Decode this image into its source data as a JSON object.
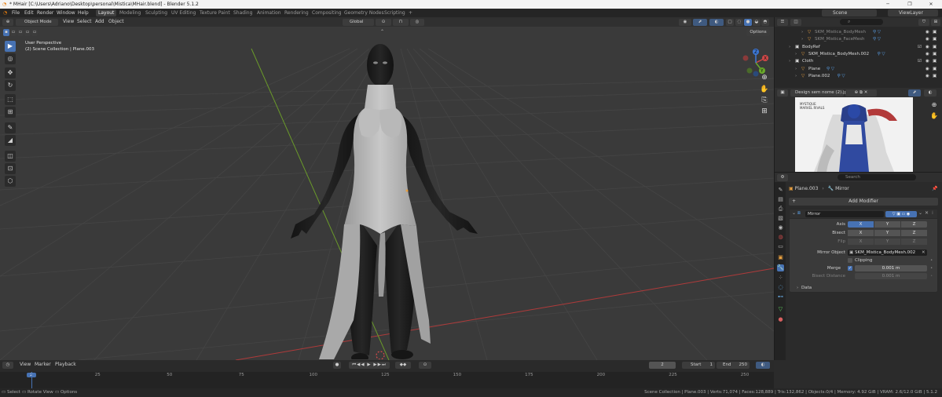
{
  "window": {
    "title": "* MHair [C:\\Users\\Adriano\\Desktop\\personal\\Mistica\\MHair.blend] - Blender 5.1.2",
    "minimize": "─",
    "maximize": "❐",
    "close": "✕"
  },
  "menu": {
    "logo": "◔",
    "items": [
      "File",
      "Edit",
      "Render",
      "Window",
      "Help"
    ],
    "workspaces": [
      "Layout",
      "Modeling",
      "Sculpting",
      "UV Editing",
      "Texture Paint",
      "Shading",
      "Animation",
      "Rendering",
      "Compositing",
      "Geometry Nodes",
      "Scripting"
    ],
    "add_workspace": "+",
    "scene": "Scene",
    "view_layer": "ViewLayer"
  },
  "viewport": {
    "mode": "Object Mode",
    "menus": [
      "View",
      "Select",
      "Add",
      "Object"
    ],
    "transform_orientation": "Global",
    "options": "Options",
    "perspective": "User Perspective",
    "collection_info": "(2) Scene Collection | Plane.003",
    "gizmo_x": "X",
    "gizmo_y": "Y",
    "gizmo_z": "Z"
  },
  "tools": [
    "▶",
    "◎",
    "✥",
    "↻",
    "⬚",
    "⊞",
    "✎",
    "◢",
    "◫",
    "⊡",
    "⬡"
  ],
  "outliner": {
    "rows": [
      {
        "name": "SKM_Mistica_BodyMesh",
        "indent": 2,
        "dim": true,
        "icon": "▽"
      },
      {
        "name": "SKM_Mistica_FaceMesh",
        "indent": 2,
        "dim": true,
        "icon": "▽"
      },
      {
        "name": "BodyRef",
        "indent": 0,
        "dim": false,
        "icon": "▣"
      },
      {
        "name": "SKM_Mistica_BodyMesh.002",
        "indent": 1,
        "dim": false,
        "icon": "▽"
      },
      {
        "name": "Cloth",
        "indent": 0,
        "dim": false,
        "icon": "▣"
      },
      {
        "name": "Plane",
        "indent": 1,
        "dim": false,
        "icon": "▽"
      },
      {
        "name": "Plane.002",
        "indent": 1,
        "dim": false,
        "icon": "▽"
      }
    ]
  },
  "image_editor": {
    "image_name": "Design sem nome (2).jpg",
    "preview_title_line1": "MYSTIQUE",
    "preview_title_line2": "MARVEL RIVALS"
  },
  "properties": {
    "search_placeholder": "Search",
    "object": "Plane.003",
    "modifier_context": "Mirror",
    "add_modifier": "Add Modifier",
    "modifier_name": "Mirror",
    "axis_label": "Axis",
    "bisect_label": "Bisect",
    "flip_label": "Flip",
    "axes": [
      "X",
      "Y",
      "Z"
    ],
    "mirror_object_label": "Mirror Object",
    "mirror_object": "SKM_Mistica_BodyMesh.002",
    "clipping_label": "Clipping",
    "merge_label": "Merge",
    "merge_value": "0.001 m",
    "bisect_distance_label": "Bisect Distance",
    "bisect_distance_value": "0.001 m",
    "data_label": "Data"
  },
  "timeline": {
    "menus": [
      "View",
      "Marker",
      "Playback"
    ],
    "current_frame": "2",
    "start_label": "Start",
    "start_value": "1",
    "end_label": "End",
    "end_value": "250",
    "ruler_ticks": [
      "2",
      "25",
      "50",
      "75",
      "100",
      "125",
      "150",
      "175",
      "200",
      "225",
      "250"
    ]
  },
  "statusbar": {
    "select": "Select",
    "rotate_view": "Rotate View",
    "options": "Options",
    "stats": "Scene Collection | Plane.003 | Verts:71,074 | Faces:128,889 | Tris:132,862 | Objects:0/4 | Memory: 4.92 GiB | VRAM: 2.6/12.0 GiB | 5.1.2"
  },
  "colors": {
    "accent": "#4772b3",
    "viewport_bg": "#3a3a3a",
    "panel_bg": "#303030",
    "header_bg": "#252525",
    "x_axis": "#b03a3a",
    "y_axis": "#6a9a2a",
    "mesh_green": "#5fd35f",
    "modifier_wrench": "#5aa0e8"
  }
}
